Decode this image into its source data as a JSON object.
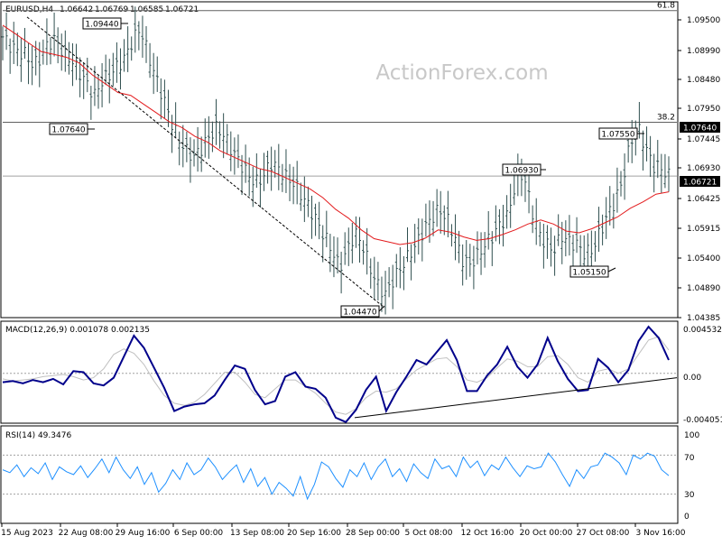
{
  "header": {
    "symbol": "EURUSD,H4",
    "open": "1.06642",
    "high": "1.06769",
    "low": "1.06585",
    "close": "1.06721"
  },
  "watermark": "ActionForex.com",
  "colors": {
    "background": "#ffffff",
    "bars": "#2f4f4f",
    "moving_average": "#e31a1c",
    "macd_line": "#00008b",
    "signal_line": "#c0c0c0",
    "rsi_line": "#1e90ff",
    "price_tag_bg": "#000000",
    "price_tag_text": "#ffffff"
  },
  "chart_data": [
    {
      "type": "candlestick-bar",
      "panel": "price",
      "ylim": [
        1.043,
        1.097
      ],
      "y_ticks": [
        "1.09500",
        "1.08990",
        "1.08480",
        "1.07950",
        "1.07445",
        "1.06930",
        "1.06425",
        "1.05915",
        "1.05400",
        "1.04890",
        "1.04385"
      ],
      "x_ticks": [
        "15 Aug 2023",
        "22 Aug 08:00",
        "29 Aug 16:00",
        "6 Sep 00:00",
        "13 Sep 08:00",
        "20 Sep 16:00",
        "28 Sep 00:00",
        "5 Oct 08:00",
        "12 Oct 16:00",
        "20 Oct 00:00",
        "27 Oct 08:00",
        "3 Nov 16:00"
      ],
      "close_path": [
        1.091,
        1.0895,
        1.0885,
        1.088,
        1.086,
        1.0875,
        1.09,
        1.0905,
        1.088,
        1.087,
        1.085,
        1.083,
        1.081,
        1.0835,
        1.0845,
        1.086,
        1.0875,
        1.0905,
        1.0925,
        1.088,
        1.084,
        1.0805,
        1.0765,
        1.0735,
        1.0715,
        1.0705,
        1.072,
        1.074,
        1.0755,
        1.074,
        1.0715,
        1.0695,
        1.0675,
        1.066,
        1.067,
        1.0695,
        1.0685,
        1.067,
        1.066,
        1.064,
        1.062,
        1.0595,
        1.057,
        1.0545,
        1.0515,
        1.0545,
        1.0575,
        1.0555,
        1.0515,
        1.0485,
        1.047,
        1.0495,
        1.0515,
        1.0535,
        1.0555,
        1.058,
        1.06,
        1.0615,
        1.06,
        1.057,
        1.053,
        1.052,
        1.0535,
        1.0555,
        1.057,
        1.059,
        1.0605,
        1.066,
        1.0678,
        1.062,
        1.0575,
        1.0555,
        1.0545,
        1.057,
        1.056,
        1.0555,
        1.054,
        1.0545,
        1.0575,
        1.0605,
        1.063,
        1.0665,
        1.073,
        1.0755,
        1.072,
        1.069,
        1.0685,
        1.0672
      ],
      "moving_average_path": [
        1.093,
        1.0915,
        1.09,
        1.0885,
        1.088,
        1.0875,
        1.0865,
        1.0845,
        1.083,
        1.0815,
        1.081,
        1.0795,
        1.078,
        1.0765,
        1.0755,
        1.074,
        1.073,
        1.0715,
        1.0705,
        1.0695,
        1.0685,
        1.068,
        1.067,
        1.066,
        1.065,
        1.0635,
        1.0615,
        1.06,
        1.058,
        1.0565,
        1.056,
        1.0555,
        1.0558,
        1.0566,
        1.058,
        1.0576,
        1.0568,
        1.0562,
        1.0565,
        1.0572,
        1.058,
        1.059,
        1.0597,
        1.059,
        1.0578,
        1.0575,
        1.0582,
        1.0592,
        1.0602,
        1.0617,
        1.0628,
        1.0641,
        1.0645
      ],
      "levels": [
        {
          "label": "61.8",
          "value": 1.0955,
          "tag": "",
          "line": true
        },
        {
          "label": "38.2",
          "value": 1.0764,
          "tag": "1.07640",
          "line": true
        },
        {
          "label": "",
          "value": 1.06721,
          "tag": "1.06721",
          "line": true
        }
      ],
      "annotations": [
        {
          "text": "1.09440",
          "value": 1.0944,
          "anchor": "left"
        },
        {
          "text": "1.07640",
          "value": 1.0764,
          "anchor": "left"
        },
        {
          "text": "1.04470",
          "value": 1.0447,
          "anchor": "bottom"
        },
        {
          "text": "1.06930",
          "value": 1.0693,
          "anchor": "right"
        },
        {
          "text": "1.05150",
          "value": 1.0515,
          "anchor": "bottom"
        },
        {
          "text": "1.07550",
          "value": 1.0755,
          "anchor": "right"
        }
      ],
      "trendline": {
        "from": 1.0944,
        "to": 1.0447
      }
    },
    {
      "type": "line",
      "panel": "macd",
      "title": "MACD(12,26,9) 0.001078 0.002135",
      "ylim": [
        -0.0045,
        0.0047
      ],
      "y_ticks": [
        "0.004532",
        "0.00",
        "-0.004051"
      ],
      "macd_path": [
        -0.0008,
        -0.0007,
        -0.0009,
        -0.0006,
        -0.0008,
        -0.0005,
        -0.001,
        0.0002,
        0.0001,
        -0.0009,
        -0.0011,
        -0.0004,
        0.0015,
        0.0034,
        0.0023,
        0.0005,
        -0.0013,
        -0.0034,
        -0.003,
        -0.0028,
        -0.0027,
        -0.002,
        -0.0006,
        0.0007,
        0.0004,
        -0.0015,
        -0.0028,
        -0.0025,
        -0.0003,
        0.0001,
        -0.0012,
        -0.0014,
        -0.0022,
        -0.004,
        -0.0044,
        -0.0033,
        -0.0015,
        -0.0003,
        -0.0034,
        -0.0017,
        -0.0003,
        0.0012,
        0.0008,
        0.0019,
        0.003,
        0.0012,
        -0.0016,
        -0.0016,
        -0.0002,
        0.0008,
        0.0024,
        0.0006,
        -0.0004,
        0.0008,
        0.0032,
        0.0011,
        -0.0005,
        -0.0016,
        -0.0015,
        0.0013,
        0.0005,
        -0.0008,
        0.0003,
        0.0029,
        0.0042,
        0.0032,
        0.0012
      ],
      "signal_path": [
        -0.0005,
        -0.0007,
        -0.0006,
        -0.0005,
        -0.0003,
        -0.0002,
        -0.0001,
        -0.0003,
        -0.0006,
        -0.0004,
        0.0004,
        0.0017,
        0.0022,
        0.0018,
        0.0008,
        -0.0007,
        -0.002,
        -0.0027,
        -0.0029,
        -0.0026,
        -0.0019,
        -0.0009,
        0.0001,
        0.0001,
        -0.0008,
        -0.0019,
        -0.0022,
        -0.0014,
        -0.0006,
        -0.0006,
        -0.0012,
        -0.0018,
        -0.0027,
        -0.0035,
        -0.0037,
        -0.0032,
        -0.0022,
        -0.0016,
        -0.0017,
        -0.0014,
        -0.0005,
        0.0003,
        0.0008,
        0.0013,
        0.0014,
        0.0006,
        -0.0006,
        -0.0008,
        -0.0004,
        0.0005,
        0.0013,
        0.0011,
        0.0006,
        0.0006,
        0.0015,
        0.0016,
        0.0008,
        -0.0004,
        -0.0008,
        0.0002,
        0.0004,
        0.0,
        0.0004,
        0.0017,
        0.003,
        0.0033,
        0.0021
      ],
      "support_line": {
        "from": -0.004,
        "to": -0.0004
      }
    },
    {
      "type": "line",
      "panel": "rsi",
      "title": "RSI(14) 49.3476",
      "ylim": [
        0,
        100
      ],
      "y_ticks": [
        "100",
        "70",
        "30",
        "0"
      ],
      "rsi_path": [
        55,
        52,
        60,
        48,
        57,
        51,
        62,
        45,
        58,
        53,
        50,
        59,
        47,
        56,
        66,
        52,
        68,
        55,
        46,
        58,
        40,
        52,
        32,
        41,
        55,
        45,
        62,
        50,
        55,
        67,
        58,
        45,
        53,
        60,
        42,
        56,
        38,
        47,
        30,
        42,
        36,
        28,
        48,
        25,
        40,
        63,
        58,
        46,
        37,
        55,
        48,
        62,
        45,
        58,
        66,
        48,
        56,
        43,
        61,
        52,
        46,
        66,
        56,
        59,
        48,
        68,
        57,
        64,
        49,
        60,
        55,
        68,
        57,
        48,
        59,
        56,
        58,
        72,
        63,
        50,
        38,
        55,
        46,
        58,
        60,
        72,
        68,
        62,
        50,
        70,
        66,
        72,
        69,
        55,
        49
      ]
    }
  ]
}
